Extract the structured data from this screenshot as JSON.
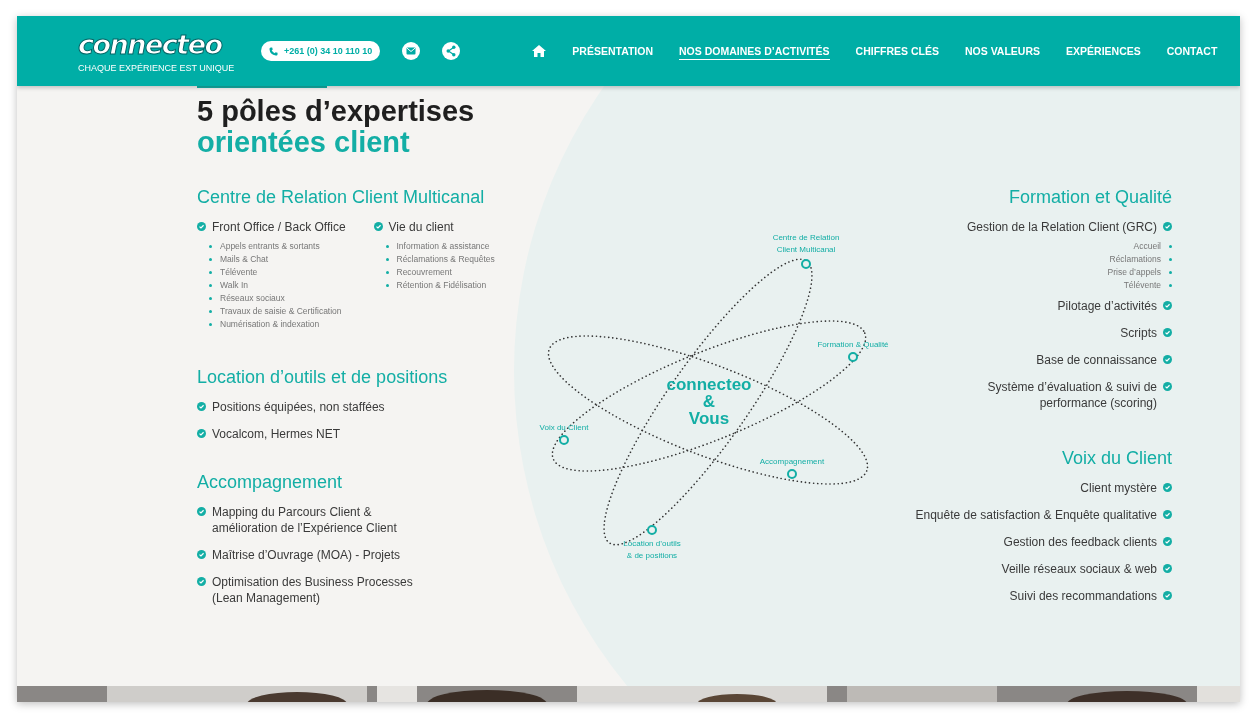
{
  "header": {
    "logo": "connecteo",
    "tagline": "CHAQUE EXPÉRIENCE EST UNIQUE",
    "phone": "+261 (0) 34 10 110 10",
    "nav": [
      {
        "label": "PRÉSENTATION",
        "selected": false
      },
      {
        "label": "NOS DOMAINES D’ACTIVITÉS",
        "selected": true
      },
      {
        "label": "CHIFFRES CLÉS",
        "selected": false
      },
      {
        "label": "NOS VALEURS",
        "selected": false
      },
      {
        "label": "EXPÉRIENCES",
        "selected": false
      },
      {
        "label": "CONTACT",
        "selected": false
      }
    ]
  },
  "title": [
    "5 pôles d’expertises",
    "orientées client"
  ],
  "left_sections": [
    {
      "title": "Centre de Relation Client Multicanal",
      "groups": [
        {
          "label": "Front Office / Back Office",
          "children": [
            "Appels entrants & sortants",
            "Mails & Chat",
            "Télévente",
            "Walk In",
            "Réseaux sociaux",
            "Travaux de saisie & Certification",
            "Numérisation & indexation"
          ]
        },
        {
          "label": "Vie du client",
          "children": [
            "Information & assistance",
            "Réclamations & Requêtes",
            "Recouvrement",
            "Rétention & Fidélisation"
          ]
        }
      ]
    },
    {
      "title": "Location d’outils et de positions",
      "items": [
        {
          "label": "Positions équipées, non staffées"
        },
        {
          "label": "Vocalcom, Hermes NET"
        }
      ]
    },
    {
      "title": "Accompagnement",
      "items": [
        {
          "label": "Mapping du Parcours Client & amélioration de l’Expérience Client"
        },
        {
          "label": "Maîtrise d’Ouvrage (MOA) - Projets"
        },
        {
          "label": "Optimisation des Business Processes (Lean Management)"
        }
      ]
    }
  ],
  "diagram": {
    "center": [
      "connecteo",
      "&",
      "Vous"
    ],
    "nodes": [
      {
        "lines": [
          "Centre de Relation",
          "Client Multicanal"
        ]
      },
      {
        "lines": [
          "Formation & Qualité"
        ]
      },
      {
        "lines": [
          "Voix du Client"
        ]
      },
      {
        "lines": [
          "Accompagnement"
        ]
      },
      {
        "lines": [
          "Location d’outils",
          "& de positions"
        ]
      }
    ]
  },
  "right_sections": [
    {
      "title": "Formation et Qualité",
      "items": [
        {
          "label": "Gestion de la Relation Client (GRC)",
          "children": [
            "Accueil",
            "Réclamations",
            "Prise d’appels",
            "Télévente"
          ]
        },
        {
          "label": "Pilotage d’activités"
        },
        {
          "label": "Scripts"
        },
        {
          "label": "Base de connaissance"
        },
        {
          "label": "Système d’évaluation & suivi de performance (scoring)"
        }
      ]
    },
    {
      "title": "Voix du Client",
      "items": [
        {
          "label": "Client mystère"
        },
        {
          "label": "Enquête de satisfaction & Enquête qualitative"
        },
        {
          "label": "Gestion des feedback clients"
        },
        {
          "label": "Veille réseaux sociaux & web"
        },
        {
          "label": "Suivi des recommandations"
        }
      ]
    }
  ]
}
